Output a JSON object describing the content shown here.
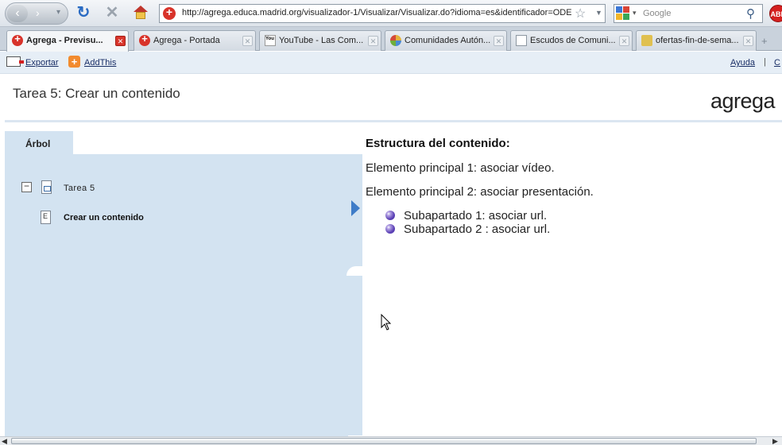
{
  "browser": {
    "url": "http://agrega.educa.madrid.org/visualizador-1/Visualizar/Visualizar.do?idioma=es&identificador=ODE-",
    "search_placeholder": "Google",
    "adblock_label": "ABP",
    "tabs": [
      {
        "label": "Agrega - Previsu...",
        "favicon": "agrega-icon",
        "active": true
      },
      {
        "label": "Agrega - Portada",
        "favicon": "agrega-icon",
        "active": false
      },
      {
        "label": "YouTube - Las Com...",
        "favicon": "youtube-icon",
        "active": false
      },
      {
        "label": "Comunidades Autón...",
        "favicon": "globe-icon",
        "active": false
      },
      {
        "label": "Escudos de Comuni...",
        "favicon": "document-icon",
        "active": false
      },
      {
        "label": "ofertas-fin-de-sema...",
        "favicon": "page-icon",
        "active": false
      }
    ]
  },
  "toolbar": {
    "export_label": "Exportar",
    "addthis_label": "AddThis",
    "help_label": "Ayuda",
    "separator": "|",
    "extra_label": "C"
  },
  "header": {
    "title": "Tarea 5: Crear un contenido",
    "brand": "agrega"
  },
  "sidebar": {
    "tab_label": "Árbol",
    "tree": {
      "root_label": "Tarea 5",
      "child_label": "Crear un contenido"
    }
  },
  "content": {
    "heading": "Estructura del contenido:",
    "items": [
      "Elemento principal 1: asociar vídeo.",
      "Elemento principal 2: asociar presentación."
    ],
    "subitems": [
      "Subapartado 1: asociar url.",
      "Subapartado 2 : asociar url."
    ]
  },
  "colors": {
    "sidebar_bg": "#d3e3f1",
    "accent_arrow": "#3e7cc8",
    "bullet": "#5a3fb4",
    "link": "#1a2f66"
  }
}
